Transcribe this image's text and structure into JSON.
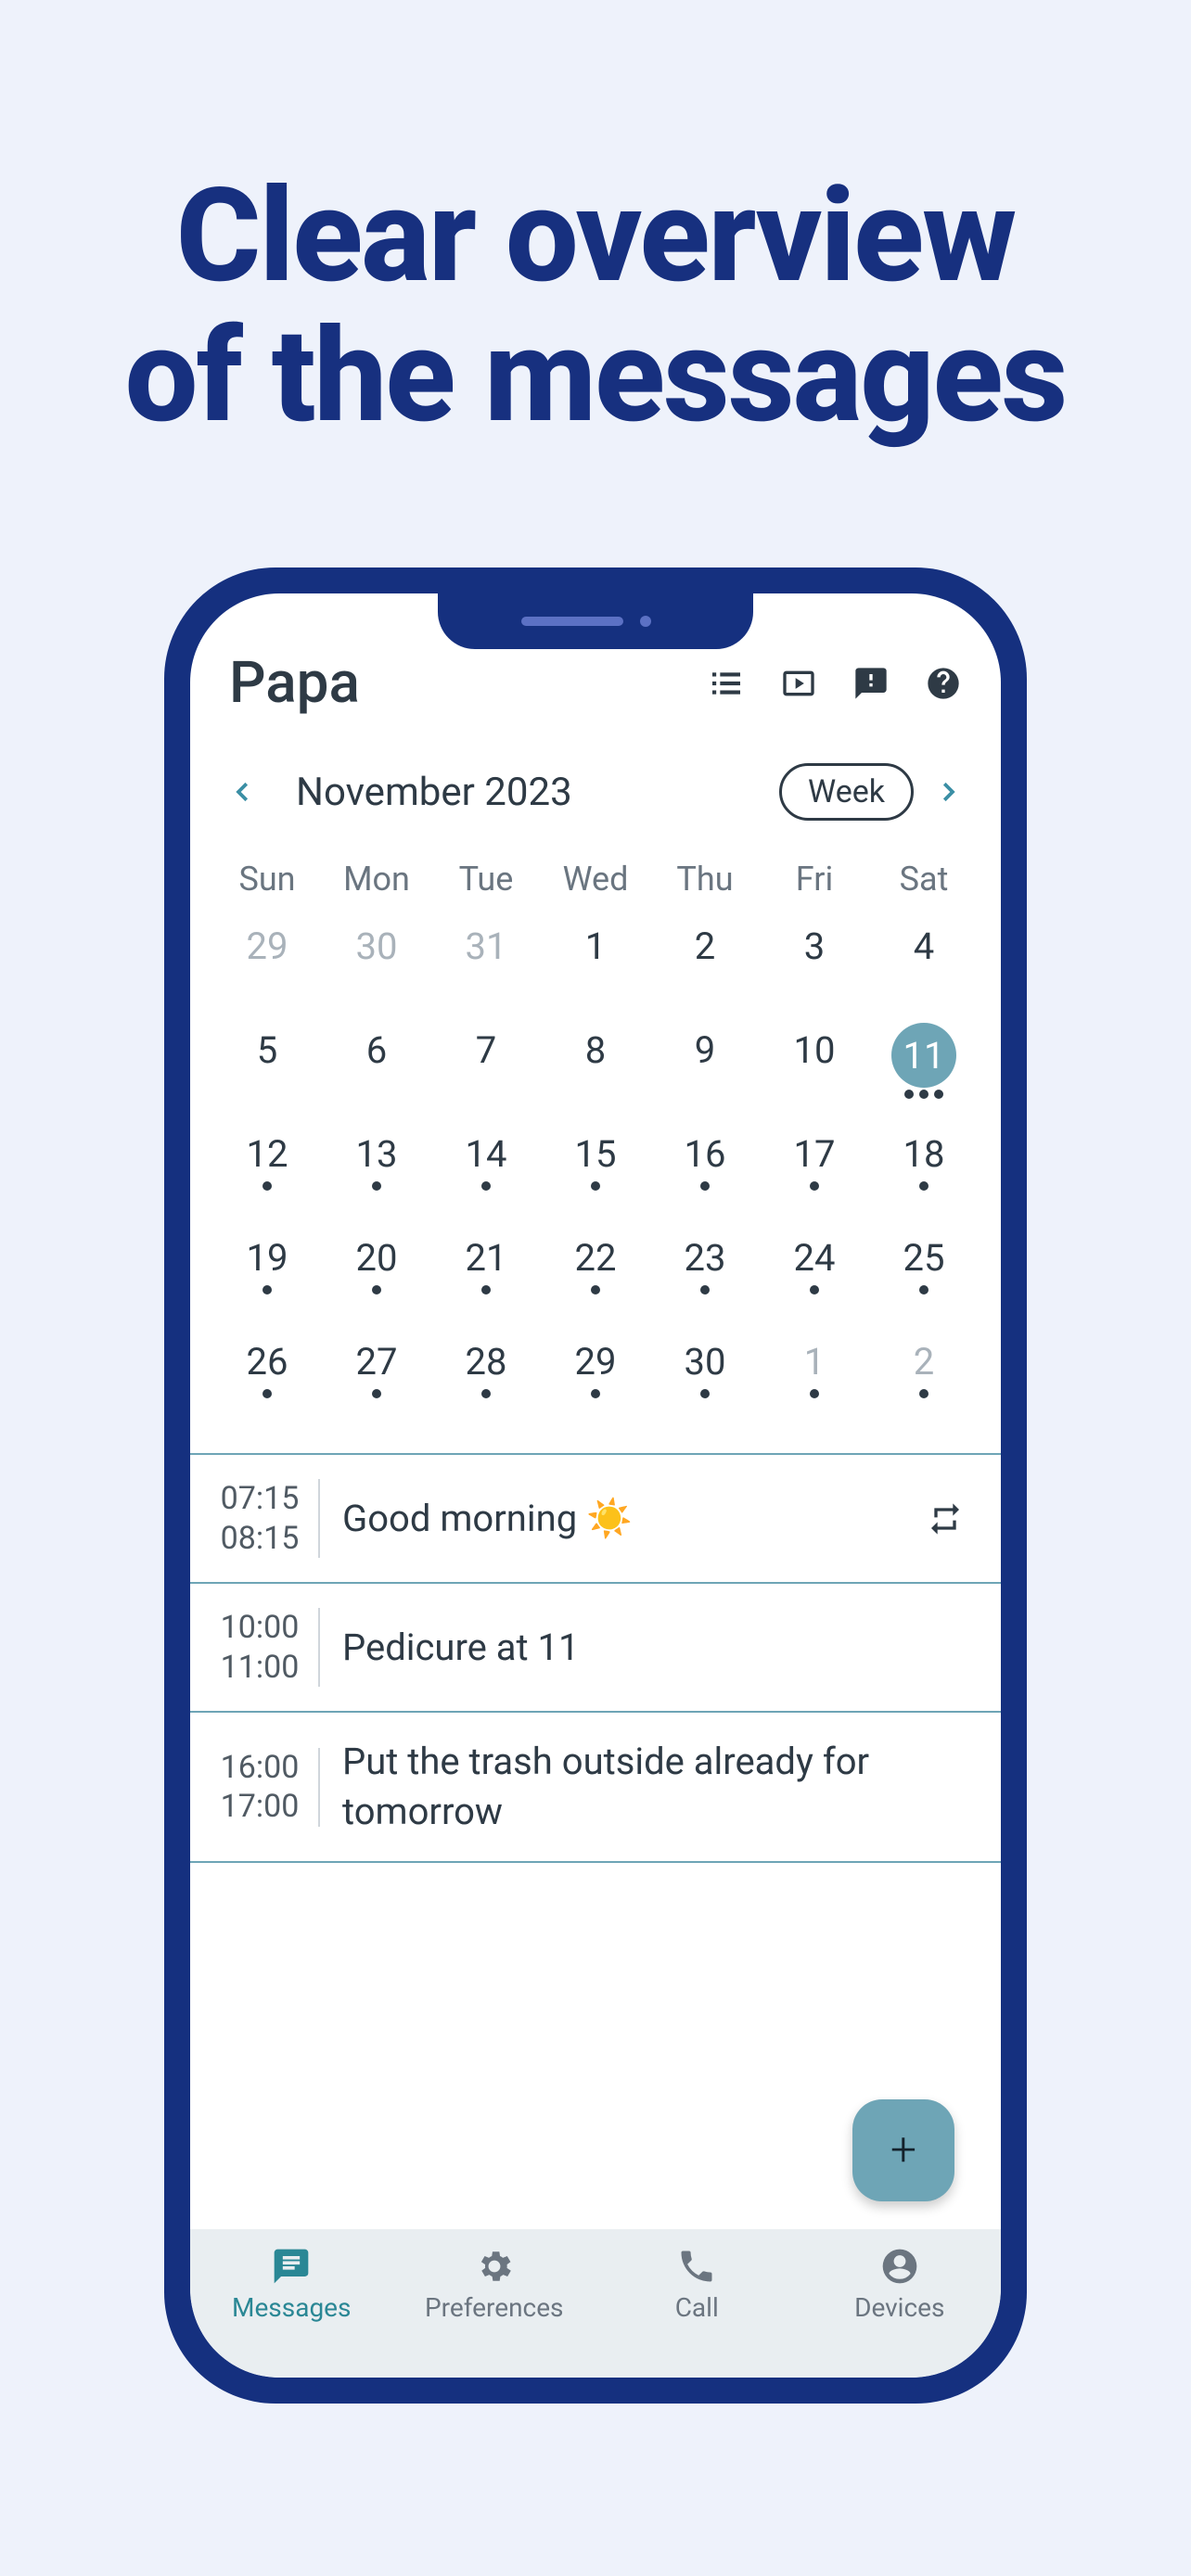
{
  "headline_line1": "Clear overview",
  "headline_line2": "of the messages",
  "header": {
    "title": "Papa",
    "icons": [
      "list-icon",
      "slideshow-icon",
      "feedback-icon",
      "help-icon"
    ]
  },
  "monthbar": {
    "label": "November 2023",
    "view_toggle": "Week"
  },
  "calendar": {
    "day_names": [
      "Sun",
      "Mon",
      "Tue",
      "Wed",
      "Thu",
      "Fri",
      "Sat"
    ],
    "weeks": [
      [
        {
          "n": "29",
          "muted": true,
          "dots": 0,
          "selected": false
        },
        {
          "n": "30",
          "muted": true,
          "dots": 0,
          "selected": false
        },
        {
          "n": "31",
          "muted": true,
          "dots": 0,
          "selected": false
        },
        {
          "n": "1",
          "muted": false,
          "dots": 0,
          "selected": false
        },
        {
          "n": "2",
          "muted": false,
          "dots": 0,
          "selected": false
        },
        {
          "n": "3",
          "muted": false,
          "dots": 0,
          "selected": false
        },
        {
          "n": "4",
          "muted": false,
          "dots": 0,
          "selected": false
        }
      ],
      [
        {
          "n": "5",
          "muted": false,
          "dots": 0,
          "selected": false
        },
        {
          "n": "6",
          "muted": false,
          "dots": 0,
          "selected": false
        },
        {
          "n": "7",
          "muted": false,
          "dots": 0,
          "selected": false
        },
        {
          "n": "8",
          "muted": false,
          "dots": 0,
          "selected": false
        },
        {
          "n": "9",
          "muted": false,
          "dots": 0,
          "selected": false
        },
        {
          "n": "10",
          "muted": false,
          "dots": 0,
          "selected": false
        },
        {
          "n": "11",
          "muted": false,
          "dots": 3,
          "selected": true
        }
      ],
      [
        {
          "n": "12",
          "muted": false,
          "dots": 1,
          "selected": false
        },
        {
          "n": "13",
          "muted": false,
          "dots": 1,
          "selected": false
        },
        {
          "n": "14",
          "muted": false,
          "dots": 1,
          "selected": false
        },
        {
          "n": "15",
          "muted": false,
          "dots": 1,
          "selected": false
        },
        {
          "n": "16",
          "muted": false,
          "dots": 1,
          "selected": false
        },
        {
          "n": "17",
          "muted": false,
          "dots": 1,
          "selected": false
        },
        {
          "n": "18",
          "muted": false,
          "dots": 1,
          "selected": false
        }
      ],
      [
        {
          "n": "19",
          "muted": false,
          "dots": 1,
          "selected": false
        },
        {
          "n": "20",
          "muted": false,
          "dots": 1,
          "selected": false
        },
        {
          "n": "21",
          "muted": false,
          "dots": 1,
          "selected": false
        },
        {
          "n": "22",
          "muted": false,
          "dots": 1,
          "selected": false
        },
        {
          "n": "23",
          "muted": false,
          "dots": 1,
          "selected": false
        },
        {
          "n": "24",
          "muted": false,
          "dots": 1,
          "selected": false
        },
        {
          "n": "25",
          "muted": false,
          "dots": 1,
          "selected": false
        }
      ],
      [
        {
          "n": "26",
          "muted": false,
          "dots": 1,
          "selected": false
        },
        {
          "n": "27",
          "muted": false,
          "dots": 1,
          "selected": false
        },
        {
          "n": "28",
          "muted": false,
          "dots": 1,
          "selected": false
        },
        {
          "n": "29",
          "muted": false,
          "dots": 1,
          "selected": false
        },
        {
          "n": "30",
          "muted": false,
          "dots": 1,
          "selected": false
        },
        {
          "n": "1",
          "muted": true,
          "dots": 1,
          "selected": false
        },
        {
          "n": "2",
          "muted": true,
          "dots": 1,
          "selected": false
        }
      ]
    ]
  },
  "messages": [
    {
      "start": "07:15",
      "end": "08:15",
      "text": "Good morning ☀️",
      "repeat": true
    },
    {
      "start": "10:00",
      "end": "11:00",
      "text": "Pedicure at 11",
      "repeat": false
    },
    {
      "start": "16:00",
      "end": "17:00",
      "text": "Put the trash outside already for tomorrow",
      "repeat": false
    }
  ],
  "fab": {
    "label": "+"
  },
  "tabs": [
    {
      "key": "messages",
      "label": "Messages",
      "icon": "chat-icon",
      "active": true
    },
    {
      "key": "preferences",
      "label": "Preferences",
      "icon": "gear-icon",
      "active": false
    },
    {
      "key": "call",
      "label": "Call",
      "icon": "phone-icon",
      "active": false
    },
    {
      "key": "devices",
      "label": "Devices",
      "icon": "person-icon",
      "active": false
    }
  ]
}
